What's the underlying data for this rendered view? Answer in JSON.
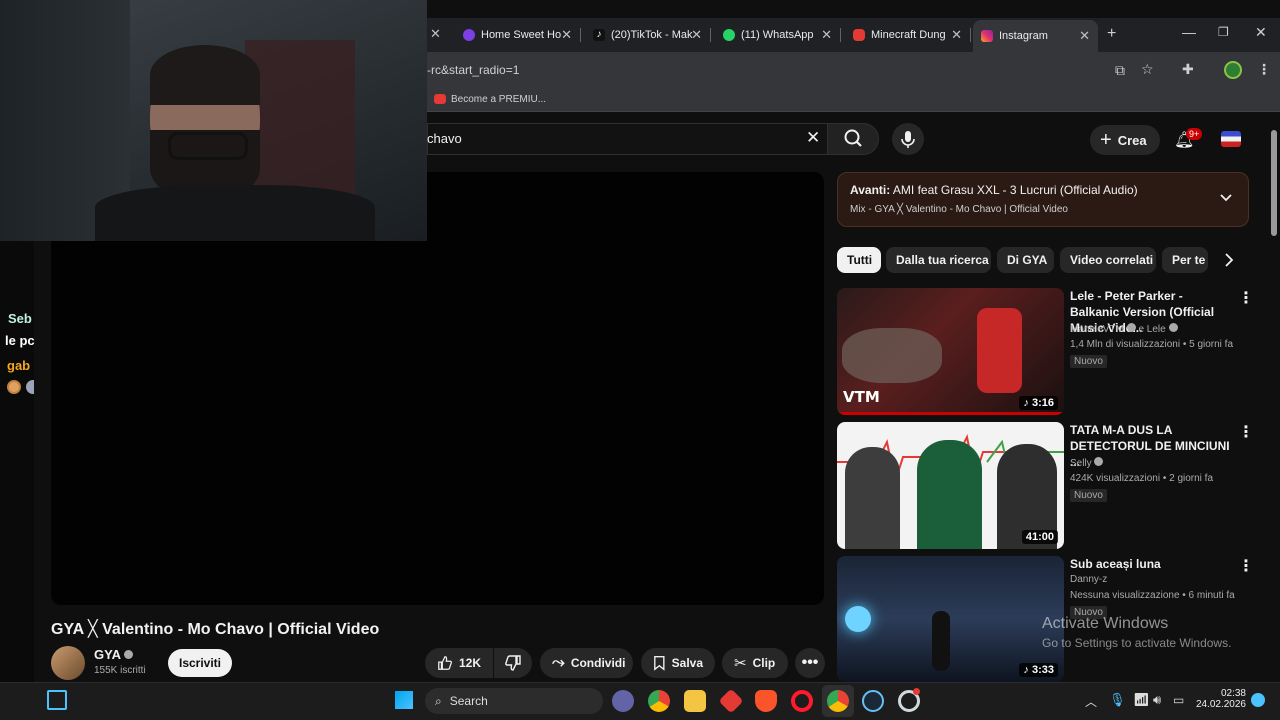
{
  "tabs": [
    {
      "title": "Home Sweet Ho",
      "color": "#7b3fe4"
    },
    {
      "title": "(20)TikTok - Mak",
      "color": "#111111"
    },
    {
      "title": "(11) WhatsApp",
      "color": "#25d366"
    },
    {
      "title": "Minecraft Dung",
      "color": "#e53935"
    },
    {
      "title": "Instagram",
      "color": "#e1306c"
    }
  ],
  "address": {
    "url": "-rc&start_radio=1"
  },
  "bookmark": {
    "label": "Become a PREMIU..."
  },
  "search": {
    "query": "chavo"
  },
  "header": {
    "create_label": "Crea",
    "notif_count": "9+"
  },
  "chat": {
    "line1": "Seb",
    "line2": "le pc",
    "line3": "gab"
  },
  "upnext": {
    "label": "Avanti:",
    "title": "AMI feat Grasu XXL - 3 Lucruri (Official Audio)",
    "subtitle": "Mix - GYA ╳ Valentino - Mo Chavo | Official Video"
  },
  "chips": [
    "Tutti",
    "Dalla tua ricerca",
    "Di GYA",
    "Video correlati",
    "Per te"
  ],
  "videos": [
    {
      "title": "Lele - Peter Parker - Balkanic Version (Official Music Vide...",
      "channel": "ManeleVTM",
      "channel2": "e Lele",
      "meta": "1,4 Mln di visualizzazioni • 5 giorni fa",
      "badge": "Nuovo",
      "duration": "3:16",
      "thumb_text": "VTM"
    },
    {
      "title": "TATA M-A DUS LA DETECTORUL DE MINCIUNI ...",
      "channel": "Selly",
      "meta": "424K visualizzazioni • 2 giorni fa",
      "badge": "Nuovo",
      "duration": "41:00"
    },
    {
      "title": "Sub aceași luna",
      "channel": "Danny-z",
      "meta": "Nessuna visualizzazione • 6 minuti fa",
      "badge": "Nuovo",
      "duration": "3:33"
    }
  ],
  "video": {
    "title": "GYA ╳ Valentino - Mo Chavo | Official Video",
    "channel": "GYA",
    "subs": "155K iscritti",
    "subscribe": "Iscriviti",
    "likes": "12K",
    "share": "Condividi",
    "save": "Salva",
    "clip": "Clip"
  },
  "watermark": {
    "line1": "Activate Windows",
    "line2": "Go to Settings to activate Windows."
  },
  "taskbar": {
    "search": "Search",
    "time": "02:38",
    "date": "24.02.2026"
  },
  "colors": {
    "accent": "#cc0000",
    "background": "#0f0f0f",
    "chip_bg": "#272727"
  }
}
